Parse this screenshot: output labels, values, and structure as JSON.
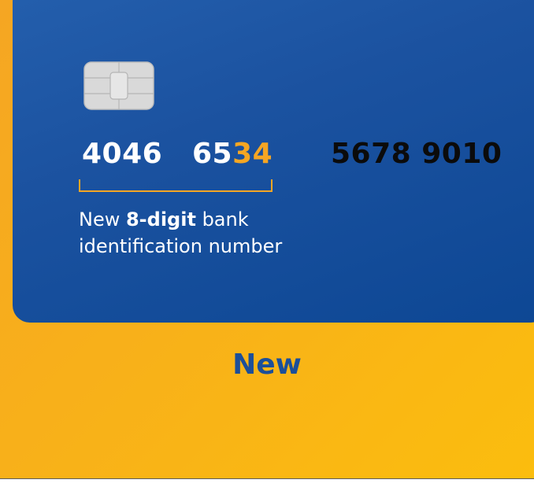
{
  "card": {
    "number": {
      "group1": "4046",
      "group2_plain": "65",
      "group2_highlight": "34",
      "group3": "5678 9010"
    },
    "bin_note": {
      "prefix": "New ",
      "emphasis": "8-digit",
      "suffix_line1": " bank",
      "line2": "identification number"
    }
  },
  "caption": "New",
  "colors": {
    "background_orange": "#f8b01a",
    "card_blue": "#1b52a0",
    "highlight_orange": "#f5a623",
    "caption_blue": "#1c4f99"
  },
  "icons": {
    "chip": "emv-chip-icon"
  }
}
